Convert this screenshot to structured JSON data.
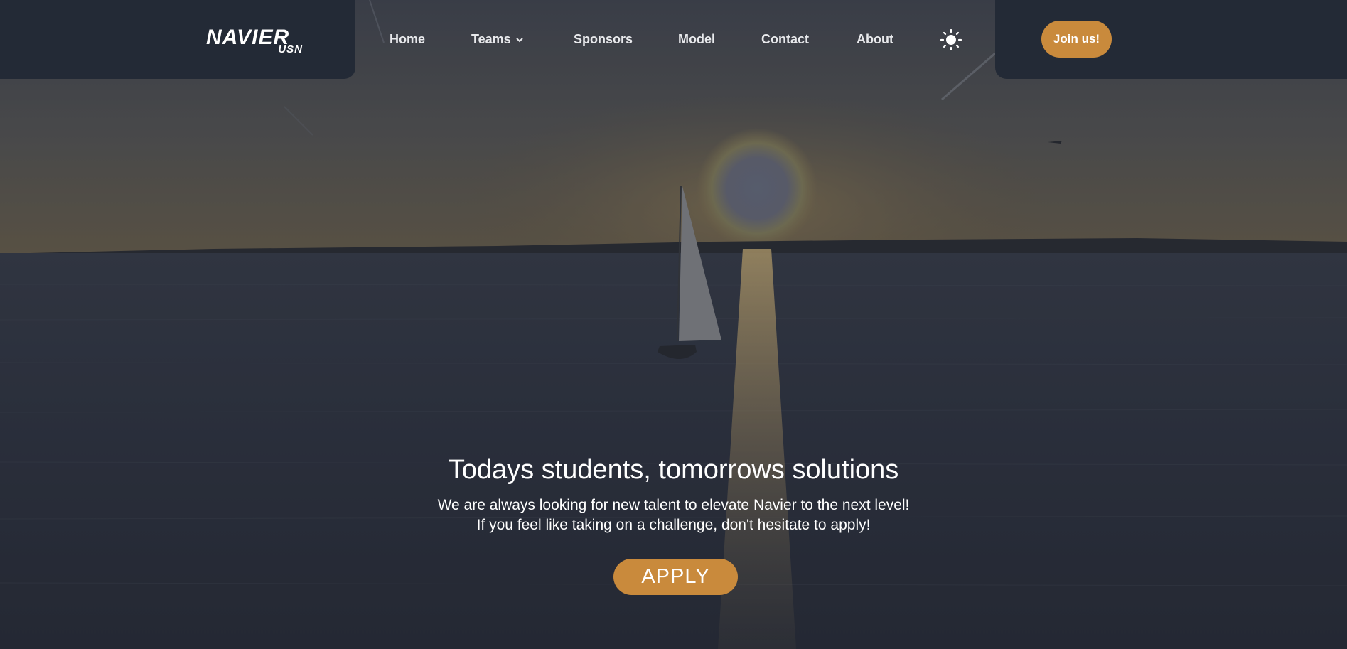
{
  "brand": {
    "logo_main": "NAVIER",
    "logo_sub": "USN"
  },
  "nav": {
    "home": "Home",
    "teams": "Teams",
    "sponsors": "Sponsors",
    "model": "Model",
    "contact": "Contact",
    "about": "About"
  },
  "header": {
    "theme_icon": "sun-icon",
    "join_label": "Join us!"
  },
  "hero": {
    "title": "Todays students, tomorrows solutions",
    "line1": "We are always looking for new talent to elevate Navier to the next level!",
    "line2": "If you feel like taking on a challenge, don't hesitate to apply!",
    "apply_label": "APPLY"
  },
  "colors": {
    "header_bg": "#232a36",
    "accent": "#c98a3c"
  }
}
